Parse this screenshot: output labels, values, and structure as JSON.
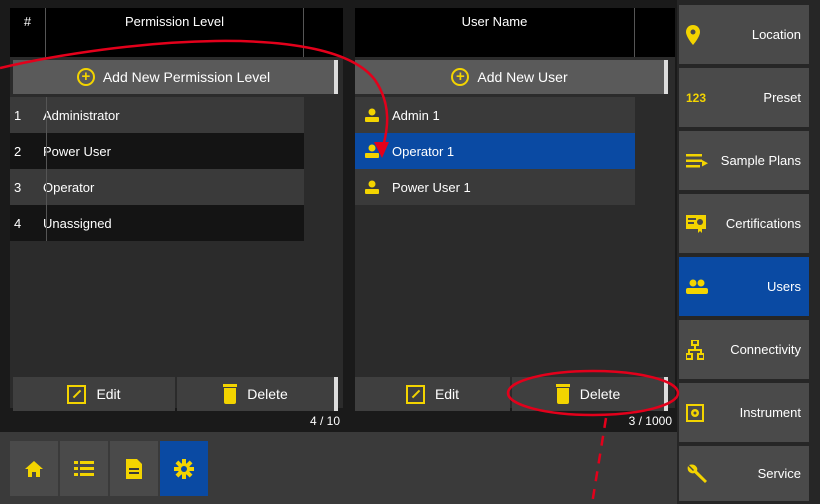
{
  "permissions": {
    "header_num": "#",
    "header_title": "Permission Level",
    "add_label": "Add New Permission Level",
    "rows": [
      {
        "num": "1",
        "label": "Administrator"
      },
      {
        "num": "2",
        "label": "Power User"
      },
      {
        "num": "3",
        "label": "Operator"
      },
      {
        "num": "4",
        "label": "Unassigned"
      }
    ],
    "edit_label": "Edit",
    "delete_label": "Delete",
    "count": "4 / 10"
  },
  "users": {
    "header_title": "User Name",
    "add_label": "Add New User",
    "rows": [
      {
        "label": "Admin 1",
        "selected": false
      },
      {
        "label": "Operator 1",
        "selected": true
      },
      {
        "label": "Power User 1",
        "selected": false
      }
    ],
    "edit_label": "Edit",
    "delete_label": "Delete",
    "count": "3 / 1000"
  },
  "sidebar": {
    "items": [
      {
        "label": "Location",
        "icon": "location-pin-icon"
      },
      {
        "label": "Preset",
        "icon": "numbers-123-icon",
        "icon_text": "123"
      },
      {
        "label": "Sample Plans",
        "icon": "list-arrow-icon"
      },
      {
        "label": "Certifications",
        "icon": "certificate-icon"
      },
      {
        "label": "Users",
        "icon": "users-icon",
        "active": true
      },
      {
        "label": "Connectivity",
        "icon": "network-icon"
      },
      {
        "label": "Instrument",
        "icon": "instrument-icon"
      },
      {
        "label": "Service",
        "icon": "wrench-icon"
      }
    ]
  },
  "bottom_nav": {
    "items": [
      {
        "icon": "home-icon"
      },
      {
        "icon": "list-icon"
      },
      {
        "icon": "document-icon"
      },
      {
        "icon": "settings-gear-icon",
        "active": true
      }
    ]
  },
  "colors": {
    "accent": "#f3d400",
    "active_blue": "#0a4aa3",
    "annotation_red": "#e3001b"
  }
}
